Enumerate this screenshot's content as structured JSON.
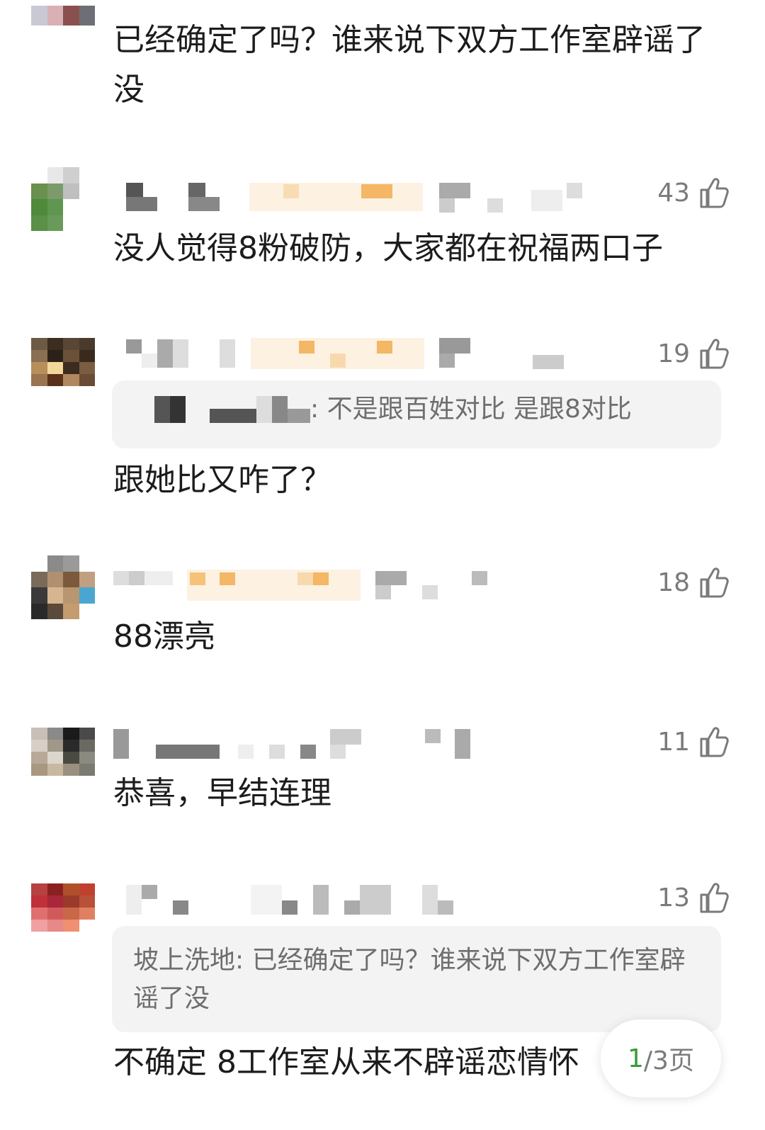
{
  "comments": [
    {
      "likes": "",
      "text": "已经确定了吗？谁来说下双方工作室辟谣了没",
      "quote_author": "",
      "quote_text": ""
    },
    {
      "likes": "43",
      "text": "没人觉得8粉破防，大家都在祝福两口子",
      "quote_author": "",
      "quote_text": ""
    },
    {
      "likes": "19",
      "text": "跟她比又咋了？",
      "quote_author": "",
      "quote_text": ": 不是跟百姓对比 是跟8对比"
    },
    {
      "likes": "18",
      "text": "88漂亮",
      "quote_author": "",
      "quote_text": ""
    },
    {
      "likes": "11",
      "text": "恭喜，早结连理",
      "quote_author": "",
      "quote_text": ""
    },
    {
      "likes": "13",
      "text": "不确定 8工作室从来不辟谣恋情怀",
      "quote_author": "坡上洗地",
      "quote_text": ": 已经确定了吗？谁来说下双方工作室辟谣了没"
    }
  ],
  "pager": {
    "current": "1",
    "total_label": "/3页"
  },
  "colors": {
    "like_gray": "#7a7a7a",
    "page_green": "#3a9a3a",
    "quote_bg": "#f3f3f3"
  },
  "icons": {
    "like": "thumbs-up-icon"
  }
}
